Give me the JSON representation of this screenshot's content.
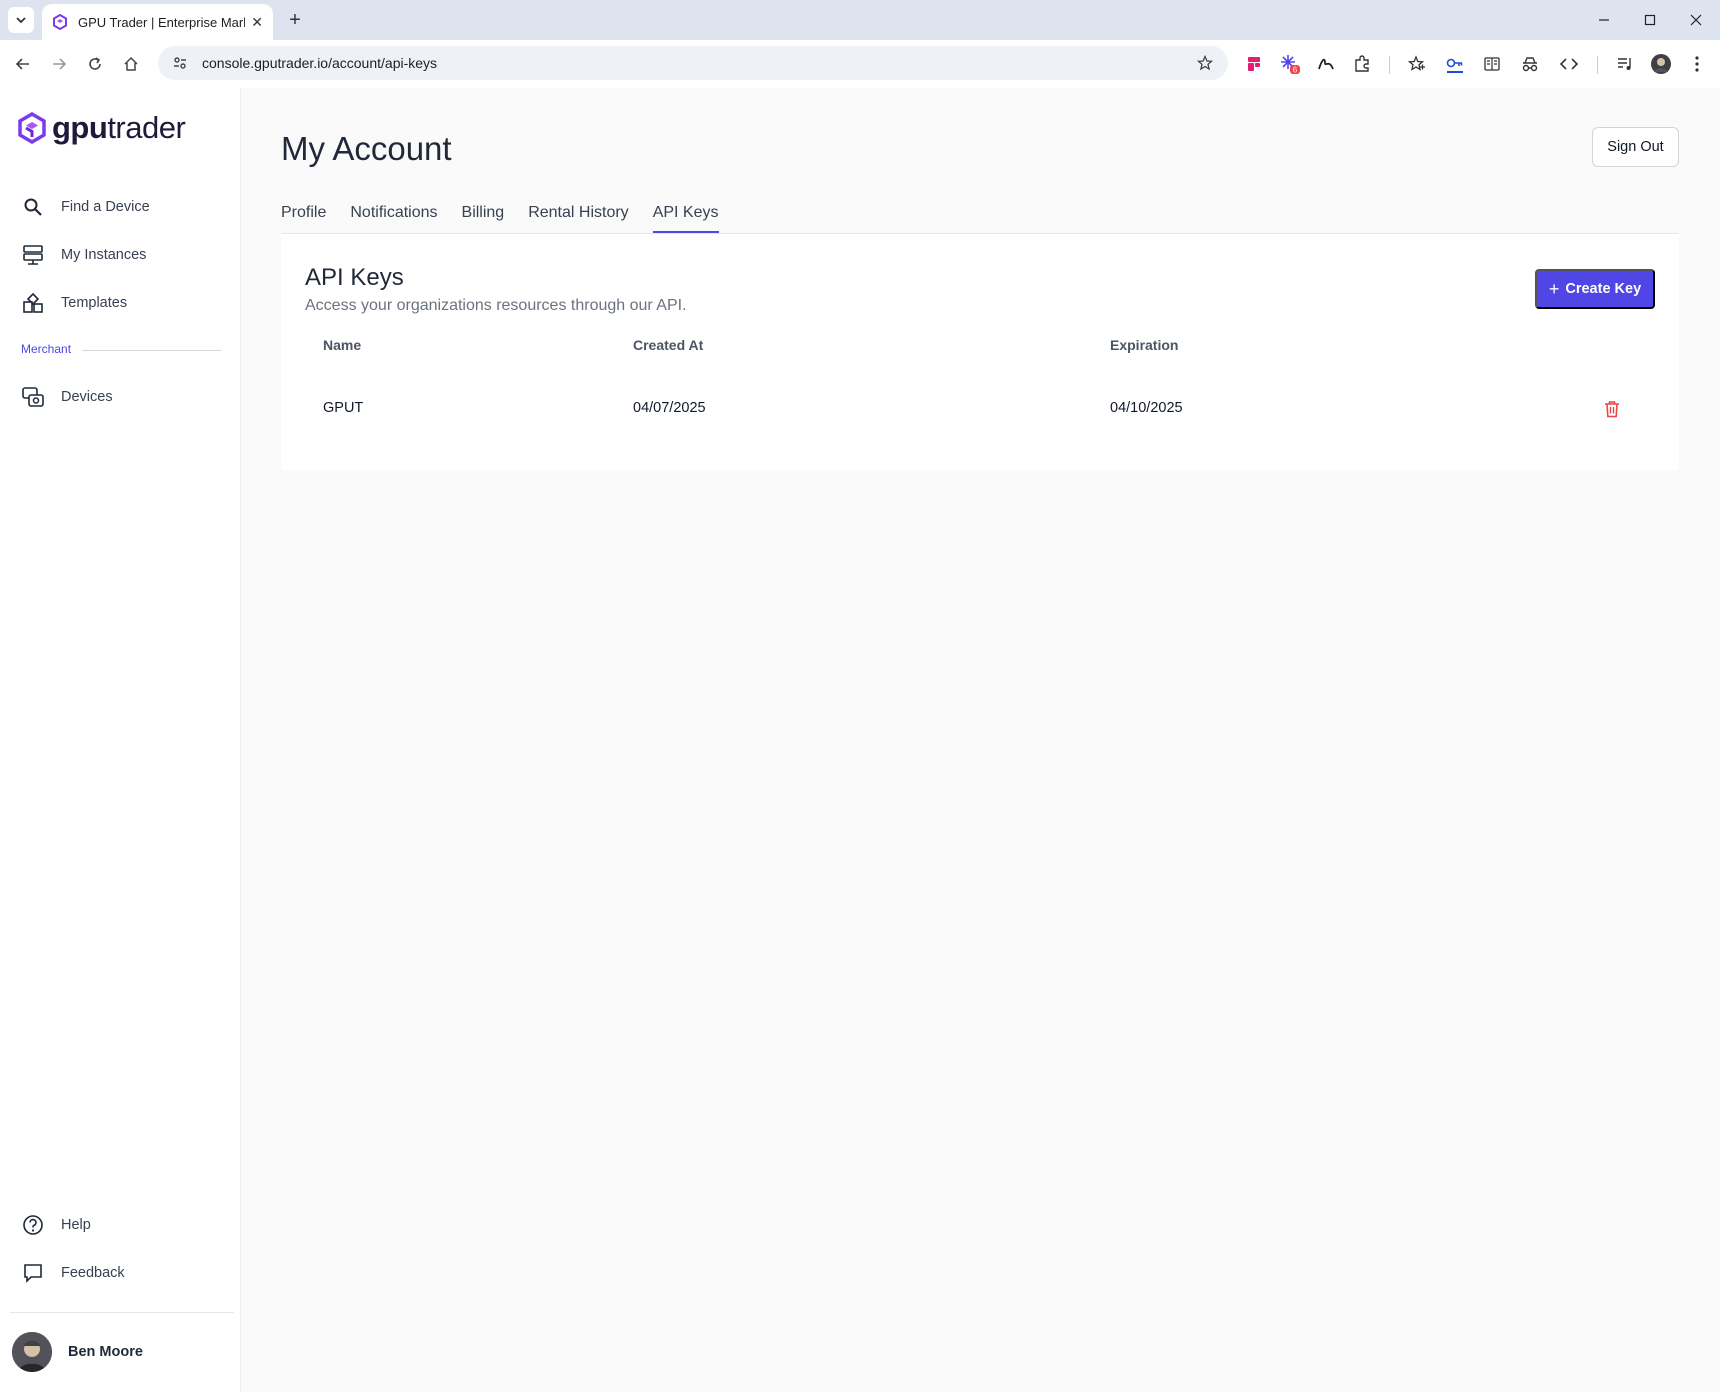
{
  "browser": {
    "tab_title": "GPU Trader | Enterprise Marketp",
    "url": "console.gputrader.io/account/api-keys",
    "extension_badge": "6"
  },
  "sidebar": {
    "logo_bold": "gpu",
    "logo_rest": "trader",
    "items": [
      {
        "label": "Find a Device",
        "icon": "search-icon"
      },
      {
        "label": "My Instances",
        "icon": "instances-icon"
      },
      {
        "label": "Templates",
        "icon": "templates-icon"
      }
    ],
    "section_label": "Merchant",
    "merchant_items": [
      {
        "label": "Devices",
        "icon": "devices-icon"
      }
    ],
    "footer_items": [
      {
        "label": "Help",
        "icon": "help-icon"
      },
      {
        "label": "Feedback",
        "icon": "feedback-icon"
      }
    ],
    "user_name": "Ben Moore"
  },
  "main": {
    "title": "My Account",
    "sign_out_label": "Sign Out",
    "tabs": [
      {
        "label": "Profile"
      },
      {
        "label": "Notifications"
      },
      {
        "label": "Billing"
      },
      {
        "label": "Rental History"
      },
      {
        "label": "API Keys",
        "active": true
      }
    ],
    "api_keys": {
      "title": "API Keys",
      "subtitle": "Access your organizations resources through our API.",
      "create_label": "Create Key",
      "columns": [
        "Name",
        "Created At",
        "Expiration"
      ],
      "rows": [
        {
          "name": "GPUT",
          "created_at": "04/07/2025",
          "expiration": "04/10/2025"
        }
      ]
    }
  },
  "colors": {
    "accent": "#4f46e5",
    "danger": "#ef4444",
    "logo_purple": "#7c3aed"
  }
}
